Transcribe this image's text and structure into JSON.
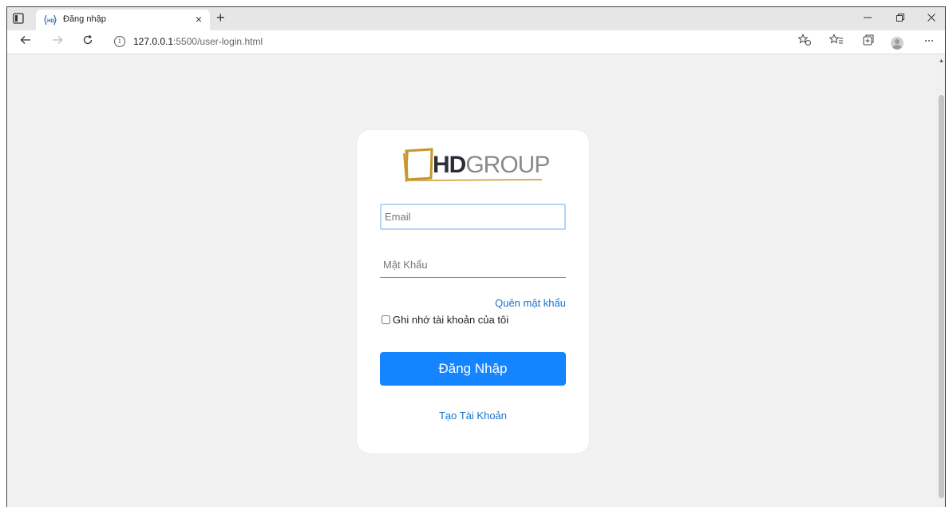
{
  "browser": {
    "tab_title": "Đăng nhập",
    "tab_close": "×",
    "new_tab": "+",
    "url_host": "127.0.0.1",
    "url_path": ":5500/user-login.html"
  },
  "page": {
    "logo": {
      "hd": "HD",
      "group": "GROUP",
      "brand_color": "#c8962a"
    },
    "email_placeholder": "Email",
    "password_placeholder": "Mật Khẩu",
    "forgot_password": "Quên mật khẩu",
    "remember_me": "Ghi nhớ tài khoản của tôi",
    "login_button": "Đăng Nhập",
    "create_account": "Tạo Tài Khoản",
    "accent_color": "#1485ff"
  }
}
